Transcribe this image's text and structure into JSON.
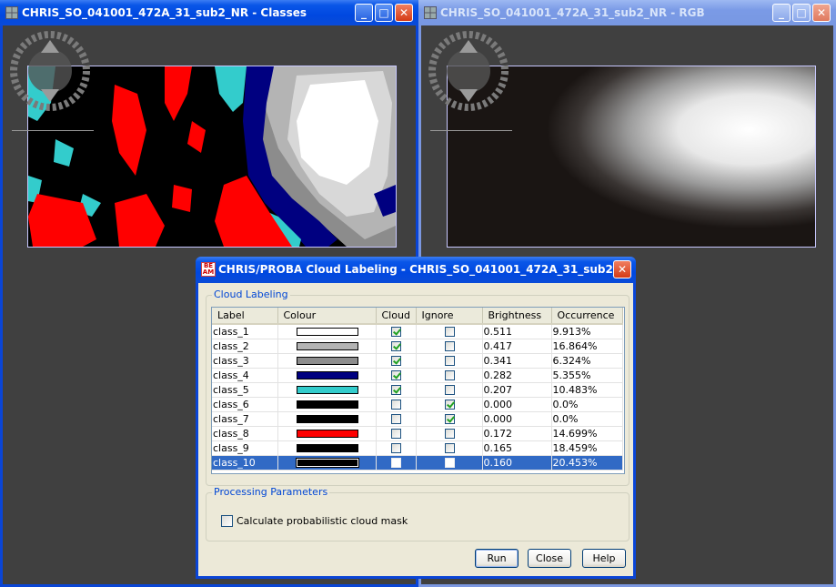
{
  "window_classes": {
    "title": "CHRIS_SO_041001_472A_31_sub2_NR - Classes"
  },
  "window_rgb": {
    "title": "CHRIS_SO_041001_472A_31_sub2_NR - RGB"
  },
  "title_buttons": {
    "minimize": "_",
    "maximize": "□",
    "close": "✕"
  },
  "dialog": {
    "title": "CHRIS/PROBA Cloud Labeling - CHRIS_SO_041001_472A_31_sub2_...",
    "icon_text": "BE AM",
    "group_cloud_labeling": "Cloud Labeling",
    "columns": [
      "Label",
      "Colour",
      "Cloud",
      "Ignore",
      "Brightness",
      "Occurrence"
    ],
    "rows": [
      {
        "label": "class_1",
        "colour": "#ffffff",
        "cloud": true,
        "ignore": false,
        "brightness": "0.511",
        "occurrence": "9.913%"
      },
      {
        "label": "class_2",
        "colour": "#b4b4b4",
        "cloud": true,
        "ignore": false,
        "brightness": "0.417",
        "occurrence": "16.864%"
      },
      {
        "label": "class_3",
        "colour": "#8c8c8c",
        "cloud": true,
        "ignore": false,
        "brightness": "0.341",
        "occurrence": "6.324%"
      },
      {
        "label": "class_4",
        "colour": "#000080",
        "cloud": true,
        "ignore": false,
        "brightness": "0.282",
        "occurrence": "5.355%"
      },
      {
        "label": "class_5",
        "colour": "#33cccc",
        "cloud": true,
        "ignore": false,
        "brightness": "0.207",
        "occurrence": "10.483%"
      },
      {
        "label": "class_6",
        "colour": "#000000",
        "cloud": false,
        "ignore": true,
        "brightness": "0.000",
        "occurrence": "0.0%"
      },
      {
        "label": "class_7",
        "colour": "#000000",
        "cloud": false,
        "ignore": true,
        "brightness": "0.000",
        "occurrence": "0.0%"
      },
      {
        "label": "class_8",
        "colour": "#ff0000",
        "cloud": false,
        "ignore": false,
        "brightness": "0.172",
        "occurrence": "14.699%"
      },
      {
        "label": "class_9",
        "colour": "#000000",
        "cloud": false,
        "ignore": false,
        "brightness": "0.165",
        "occurrence": "18.459%"
      },
      {
        "label": "class_10",
        "colour": "#000000",
        "cloud": false,
        "ignore": false,
        "brightness": "0.160",
        "occurrence": "20.453%",
        "selected": true
      }
    ],
    "group_processing": "Processing Parameters",
    "prob_mask_label": "Calculate probabilistic cloud mask",
    "prob_mask_checked": false,
    "buttons": {
      "run": "Run",
      "close": "Close",
      "help": "Help"
    }
  },
  "colors": {
    "accent": "#0a45d6",
    "selection": "#316ac5",
    "dialog_bg": "#ece9d8",
    "canvas_bg": "#404040"
  }
}
